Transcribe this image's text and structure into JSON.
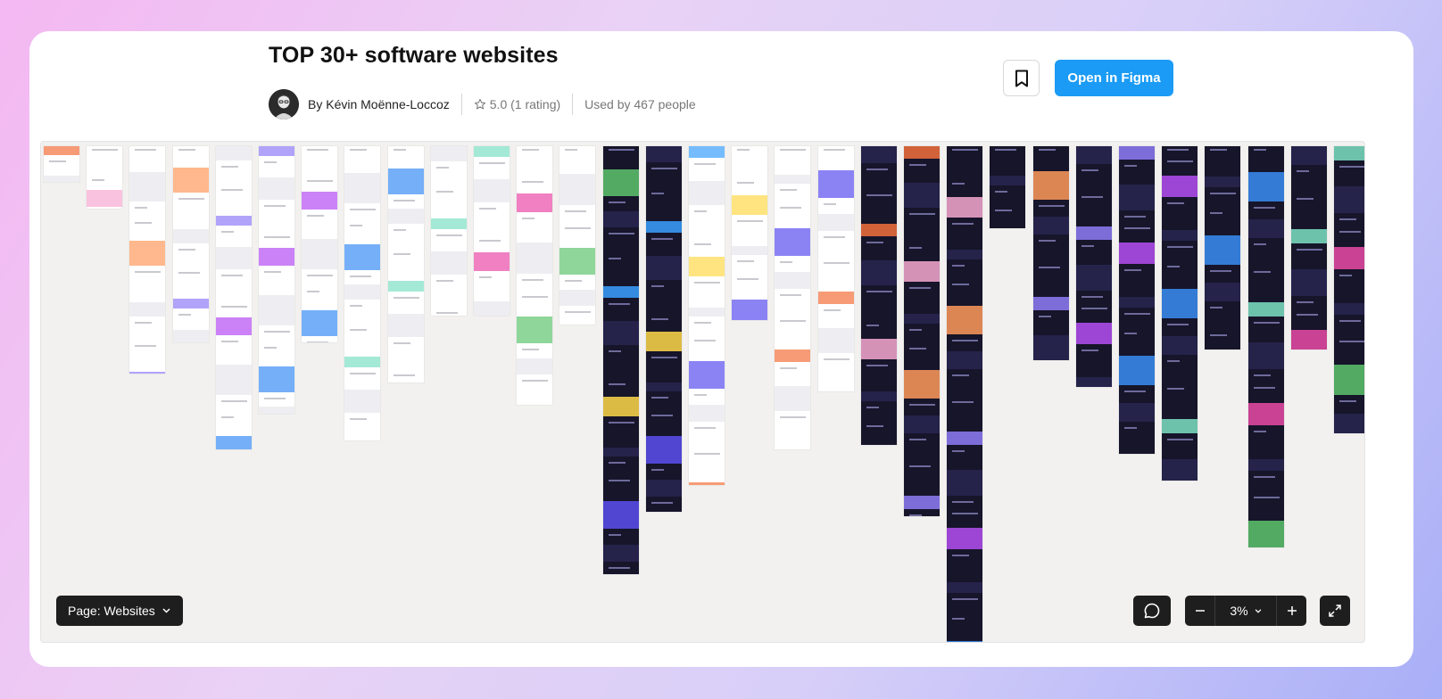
{
  "header": {
    "title": "TOP 30+ software websites",
    "author": "By Kévin Moënne-Loccoz",
    "rating": "5.0 (1 rating)",
    "used_by": "Used by 467 people"
  },
  "actions": {
    "open_in_figma": "Open in Figma"
  },
  "canvas_controls": {
    "page_selector": "Page: Websites",
    "zoom_level": "3%"
  },
  "icons": [
    "star-icon",
    "bookmark-icon",
    "chevron-down-icon",
    "comment-icon",
    "minus-icon",
    "plus-icon",
    "expand-icon"
  ],
  "colors": {
    "accent": "#1b9bf5",
    "control_bg": "#1e1e1e",
    "canvas_bg": "#f2f1ef"
  }
}
